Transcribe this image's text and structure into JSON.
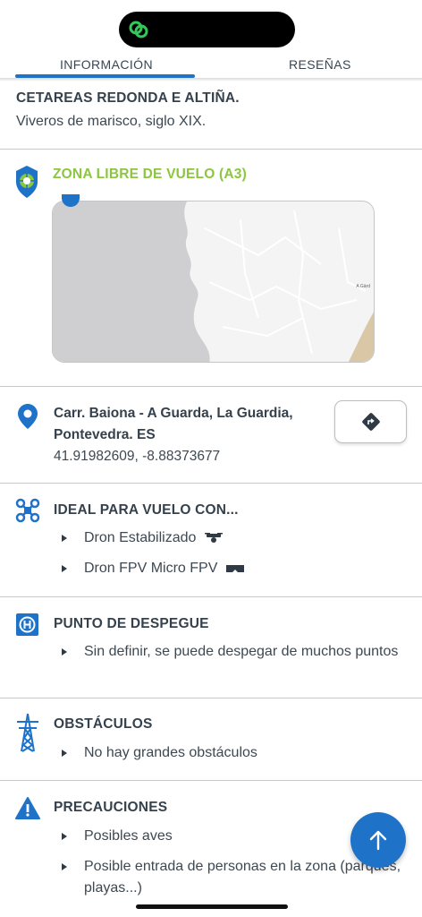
{
  "tabs": [
    {
      "label": "INFORMACIÓN",
      "active": true
    },
    {
      "label": "RESEÑAS",
      "active": false
    }
  ],
  "spot": {
    "name": "CETAREAS REDONDA E ALTIÑA.",
    "subtitle": "Viveros de marisco, siglo XIX."
  },
  "zone": {
    "label": "ZONA LIBRE DE VUELO (A3)",
    "map_place_label": "A Gärd"
  },
  "location": {
    "address": "Carr. Baiona - A Guarda, La Guardia, Pontevedra. ES",
    "coordinates": "41.91982609, -8.88373677",
    "directions_icon": "directions-icon"
  },
  "ideal_flight": {
    "title": "IDEAL PARA VUELO CON...",
    "items": [
      "Dron Estabilizado",
      "Dron FPV Micro FPV"
    ]
  },
  "takeoff": {
    "title": "PUNTO DE DESPEGUE",
    "items": [
      "Sin definir, se puede despegar de muchos puntos"
    ]
  },
  "obstacles": {
    "title": "OBSTÁCULOS",
    "items": [
      "No hay grandes obstáculos"
    ]
  },
  "precautions": {
    "title": "PRECAUCIONES",
    "items": [
      "Posibles aves",
      "Posible entrada de personas en la zona (parques, playas...)"
    ]
  },
  "colors": {
    "accent": "#1e73c8",
    "zone_green": "#8cc63f",
    "text": "#35414c"
  }
}
